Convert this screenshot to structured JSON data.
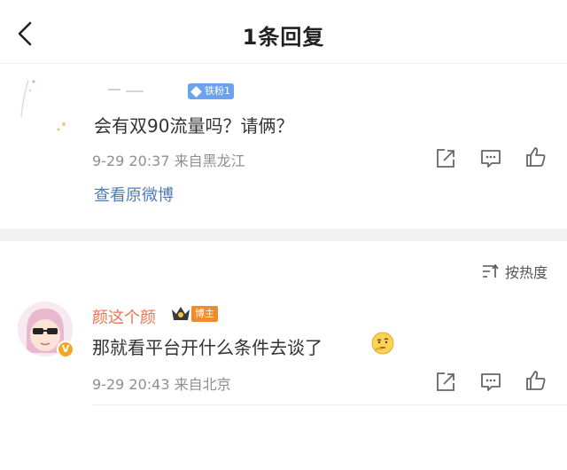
{
  "header": {
    "title": "1条回复",
    "back_icon": "chevron-left-icon"
  },
  "original": {
    "fan_badge": "铁粉1",
    "text": "会有双90流量吗？请俩？",
    "meta": "9-29 20:37 来自黑龙江",
    "view_original": "查看原微博",
    "actions": [
      "share-icon",
      "comment-icon",
      "like-icon"
    ]
  },
  "sort": {
    "label": "按热度",
    "icon": "sort-icon"
  },
  "comment": {
    "username": "颜这个颜",
    "badge": "博主",
    "text": "那就看平台开什么条件去谈了",
    "meta": "9-29 20:43 来自北京",
    "verified_mark": "V",
    "actions": [
      "share-icon",
      "comment-icon",
      "like-icon"
    ]
  },
  "colors": {
    "username": "#eb7350",
    "link": "#507daf",
    "fan_badge": "#6aa2f0",
    "blogger_badge": "#f08b2c",
    "verified": "#f5a623"
  }
}
